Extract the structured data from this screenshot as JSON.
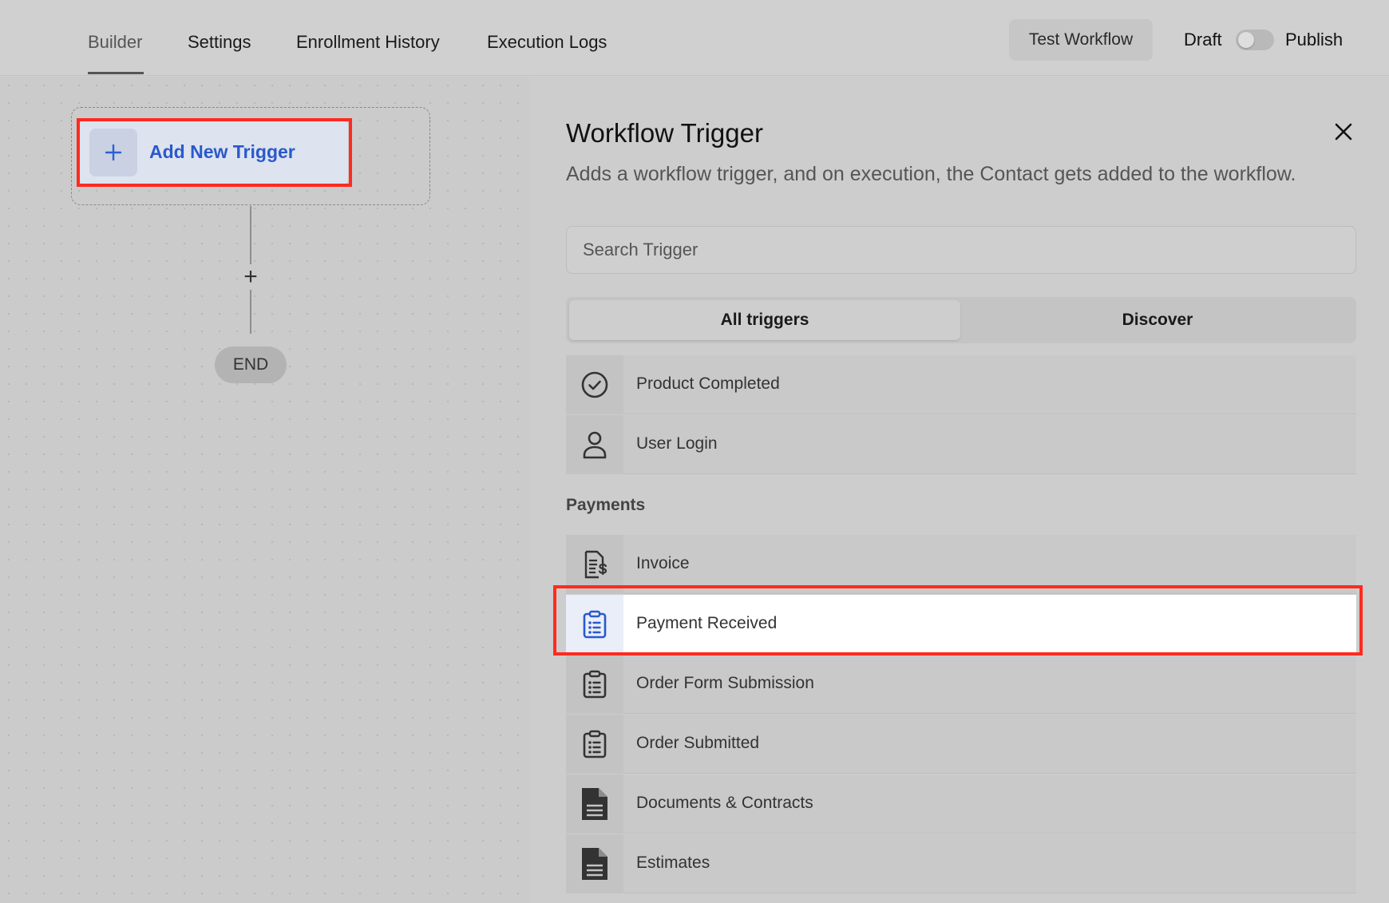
{
  "tabs": [
    {
      "label": "Builder",
      "active": true
    },
    {
      "label": "Settings",
      "active": false
    },
    {
      "label": "Enrollment History",
      "active": false
    },
    {
      "label": "Execution Logs",
      "active": false
    }
  ],
  "toolbar": {
    "test_label": "Test Workflow",
    "draft_label": "Draft",
    "publish_label": "Publish",
    "published": false
  },
  "canvas": {
    "trigger_label": "Add New Trigger",
    "add_step_symbol": "+",
    "end_label": "END"
  },
  "panel": {
    "title": "Workflow Trigger",
    "description": "Adds a workflow trigger, and on execution, the Contact gets added to the workflow.",
    "search_placeholder": "Search Trigger",
    "segments": [
      "All triggers",
      "Discover"
    ],
    "list_before": [
      {
        "label": "Product Completed",
        "icon": "check-circle-icon"
      },
      {
        "label": "User Login",
        "icon": "user-icon"
      }
    ],
    "section": "Payments",
    "payments": [
      {
        "label": "Invoice",
        "icon": "invoice-dollar-icon",
        "selected": false
      },
      {
        "label": "Payment Received",
        "icon": "clipboard-list-icon",
        "selected": true
      },
      {
        "label": "Order Form Submission",
        "icon": "clipboard-list-icon",
        "selected": false
      },
      {
        "label": "Order Submitted",
        "icon": "clipboard-list-icon",
        "selected": false
      },
      {
        "label": "Documents & Contracts",
        "icon": "document-icon",
        "selected": false
      },
      {
        "label": "Estimates",
        "icon": "document-icon",
        "selected": false
      }
    ]
  },
  "colors": {
    "highlight": "#ff2a1f",
    "accent": "#2a59cc"
  }
}
